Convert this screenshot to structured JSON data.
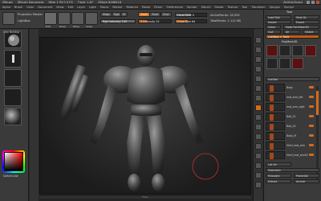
{
  "titlebar": {
    "items": [
      "ZBrush",
      "ZBrush Document",
      "Mem 1 P4 0 0 F9",
      "Timer 1.87",
      "ZStore 8098416"
    ],
    "right": "ZeliCel/Script"
  },
  "menubar": [
    "Alpha",
    "Brush",
    "Color",
    "Document",
    "Draw",
    "Edit",
    "Layer",
    "Light",
    "Macro",
    "Marker",
    "Material",
    "Movie",
    "Picker",
    "Preferences",
    "Render",
    "Stencil",
    "Stroke",
    "Texture",
    "Tool",
    "Transform",
    "Zplugin",
    "Zscript"
  ],
  "toolbar": {
    "projection_master": "Projection Master",
    "lightbox": "LightBox",
    "edit": "Edit",
    "draw": "Draw",
    "move": "Move",
    "scale": "Scale",
    "rotate": "Rotate",
    "mrgb": "Mrgb",
    "rgb": "Rgb",
    "m": "M",
    "zadd": "Zadd",
    "zsub": "Zsub",
    "zcut": "Zcut",
    "rgb_intensity": "Rgb Intensity 100",
    "z_intensity": "Z Intensity 25",
    "focal_shift": "Focal Shift 0",
    "draw_size": "Draw Size 64",
    "active_points": "ActivePoints: 34,992",
    "total_points": "TotalPoints: 1.112 Mil"
  },
  "leftbar": {
    "brush_label": "Clay Buildup",
    "switch_color": "SwitchColor"
  },
  "viewport": {
    "floor_label": "Floor"
  },
  "rightpanel": {
    "title": "Tool",
    "load_tool": "Load Tool",
    "save_as": "Save As",
    "import": "Import",
    "export": "Export",
    "clone": "Clone",
    "make_polymesh": "Make PolyMesh3D",
    "goz": "GoZ",
    "all": "All",
    "visible": "Visible",
    "lightbox_tools": "Lightbox > Tools",
    "tool_name": "PolyMesh3D",
    "subtool": "SubTool",
    "subtools": [
      "Body",
      "mat_arm_left",
      "mat_arm_right",
      "Bolt_01",
      "Bolt_02",
      "Body_M",
      "Shell_mat_arm",
      "Shell_mat_arm02"
    ],
    "list_all": "List All",
    "geometry": "Geometry",
    "polypaint": "Polypaint",
    "projection": "ProjectAll",
    "extract": "Extract",
    "accept": "Accept"
  },
  "colors": {
    "accent": "#d46a1a",
    "panel": "#3a3a3a",
    "viewport": "#1c1c1c"
  }
}
